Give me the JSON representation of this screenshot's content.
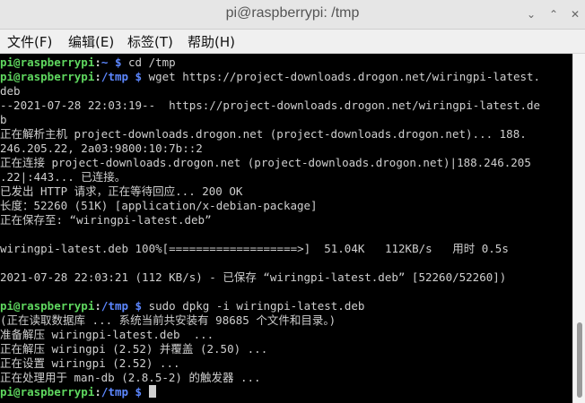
{
  "window": {
    "title": "pi@raspberrypi: /tmp",
    "controls": {
      "minimize": "⌄",
      "maximize": "⌃",
      "close": "✕"
    }
  },
  "menubar": {
    "items": [
      {
        "label": "文件(F)"
      },
      {
        "label": "编辑(E)"
      },
      {
        "label": "标签(T)"
      },
      {
        "label": "帮助(H)"
      }
    ]
  },
  "terminal": {
    "lines": [
      {
        "prompt_user": "pi@raspberrypi",
        "prompt_path": "~",
        "prompt_symbol": "$",
        "command": " cd /tmp"
      },
      {
        "prompt_user": "pi@raspberrypi",
        "prompt_path": "/tmp",
        "prompt_symbol": "$",
        "command": " wget https://project-downloads.drogon.net/wiringpi-latest."
      },
      {
        "text": "deb"
      },
      {
        "text": "--2021-07-28 22:03:19--  https://project-downloads.drogon.net/wiringpi-latest.de"
      },
      {
        "text": "b"
      },
      {
        "text": "正在解析主机 project-downloads.drogon.net (project-downloads.drogon.net)... 188."
      },
      {
        "text": "246.205.22, 2a03:9800:10:7b::2"
      },
      {
        "text": "正在连接 project-downloads.drogon.net (project-downloads.drogon.net)|188.246.205"
      },
      {
        "text": ".22|:443... 已连接。"
      },
      {
        "text": "已发出 HTTP 请求，正在等待回应... 200 OK"
      },
      {
        "text": "长度：52260 (51K) [application/x-debian-package]"
      },
      {
        "text": "正在保存至: “wiringpi-latest.deb”"
      },
      {
        "text": ""
      },
      {
        "text": "wiringpi-latest.deb 100%[===================>]  51.04K   112KB/s   用时 0.5s"
      },
      {
        "text": ""
      },
      {
        "text": "2021-07-28 22:03:21 (112 KB/s) - 已保存 “wiringpi-latest.deb” [52260/52260])"
      },
      {
        "text": ""
      },
      {
        "prompt_user": "pi@raspberrypi",
        "prompt_path": "/tmp",
        "prompt_symbol": "$",
        "command": " sudo dpkg -i wiringpi-latest.deb"
      },
      {
        "text": "(正在读取数据库 ... 系统当前共安装有 98685 个文件和目录。)"
      },
      {
        "text": "准备解压 wiringpi-latest.deb  ..."
      },
      {
        "text": "正在解压 wiringpi (2.52) 并覆盖 (2.50) ..."
      },
      {
        "text": "正在设置 wiringpi (2.52) ..."
      },
      {
        "text": "正在处理用于 man-db (2.8.5-2) 的触发器 ..."
      },
      {
        "prompt_user": "pi@raspberrypi",
        "prompt_path": "/tmp",
        "prompt_symbol": "$",
        "command": " ",
        "cursor": true
      }
    ]
  },
  "colors": {
    "prompt_user": "#5fd75f",
    "prompt_path": "#5c87ff",
    "text": "#cfcfcf",
    "background": "#000000"
  }
}
